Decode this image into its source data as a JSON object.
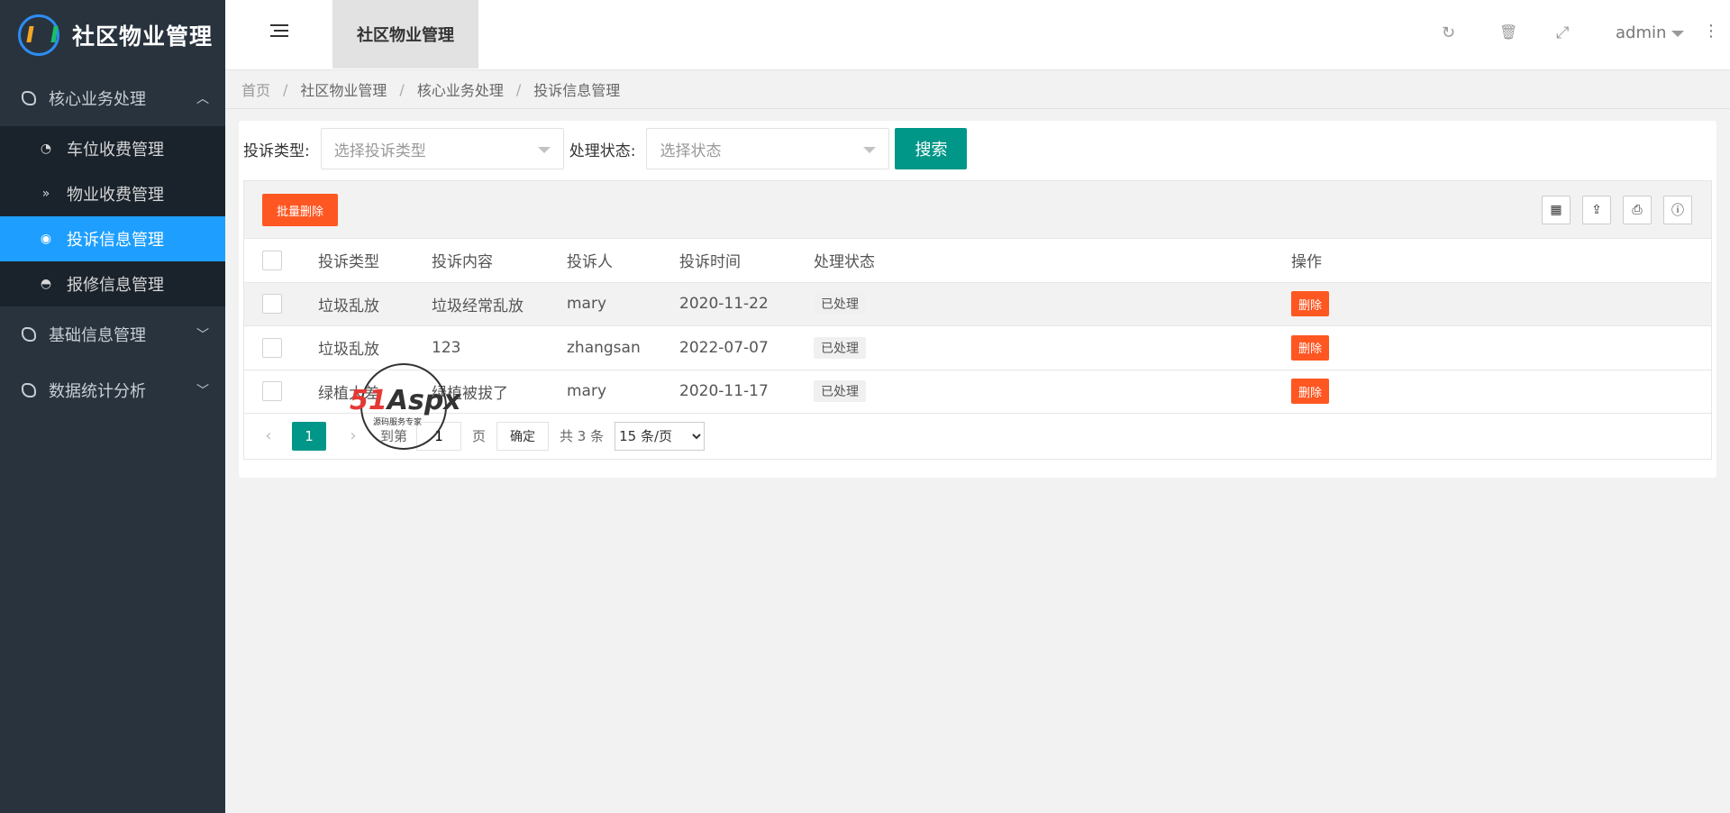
{
  "app": {
    "title": "社区物业管理",
    "colors": {
      "sidebar_bg": "#28333e",
      "submenu_bg": "#1a232c",
      "active": "#1e9fff",
      "primary": "#009688",
      "danger": "#ff5722"
    }
  },
  "sidebar": {
    "groups": [
      {
        "label": "核心业务处理",
        "expanded": true,
        "arrow": "︿"
      },
      {
        "label": "基础信息管理",
        "expanded": false,
        "arrow": "﹀"
      },
      {
        "label": "数据统计分析",
        "expanded": false,
        "arrow": "﹀"
      }
    ],
    "sub_items": [
      {
        "label": "车位收费管理",
        "icon": "dashboard-icon",
        "glyph": "◔"
      },
      {
        "label": "物业收费管理",
        "icon": "chevron-double-down-icon",
        "glyph": "»"
      },
      {
        "label": "投诉信息管理",
        "icon": "target-icon",
        "glyph": "◉",
        "active": true
      },
      {
        "label": "报修信息管理",
        "icon": "chart-circle-icon",
        "glyph": "◓"
      }
    ]
  },
  "header": {
    "tab_label": "社区物业管理",
    "user": "admin",
    "icons": {
      "refresh": "↻",
      "trash": "🗑",
      "fullscreen": "⤢",
      "more": "⋮"
    }
  },
  "breadcrumb": [
    "首页",
    "社区物业管理",
    "核心业务处理",
    "投诉信息管理"
  ],
  "breadcrumb_sep": "/",
  "search": {
    "type_label": "投诉类型:",
    "type_placeholder": "选择投诉类型",
    "status_label": "处理状态:",
    "status_placeholder": "选择状态",
    "button": "搜索"
  },
  "toolbar": {
    "batch_delete": "批量删除",
    "icons": {
      "columns": "▦",
      "export": "⇪",
      "print": "⎙",
      "info": "ⓘ"
    }
  },
  "table": {
    "columns": [
      "投诉类型",
      "投诉内容",
      "投诉人",
      "投诉时间",
      "处理状态",
      "操作"
    ],
    "rows": [
      {
        "type": "垃圾乱放",
        "content": "垃圾经常乱放",
        "person": "mary",
        "time": "2020-11-22",
        "status": "已处理",
        "action": "删除"
      },
      {
        "type": "垃圾乱放",
        "content": "123",
        "person": "zhangsan",
        "time": "2022-07-07",
        "status": "已处理",
        "action": "删除"
      },
      {
        "type": "绿植太差",
        "content": "绿植被拔了",
        "person": "mary",
        "time": "2020-11-17",
        "status": "已处理",
        "action": "删除"
      }
    ]
  },
  "pager": {
    "prev": "‹",
    "current": "1",
    "next": "›",
    "goto_label": "到第",
    "goto_value": "1",
    "page_unit": "页",
    "ok": "确定",
    "total": "共 3 条",
    "limit": "15 条/页"
  },
  "watermark": {
    "brand_red": "51",
    "brand": "Aspx",
    "sub": "源码服务专家"
  }
}
